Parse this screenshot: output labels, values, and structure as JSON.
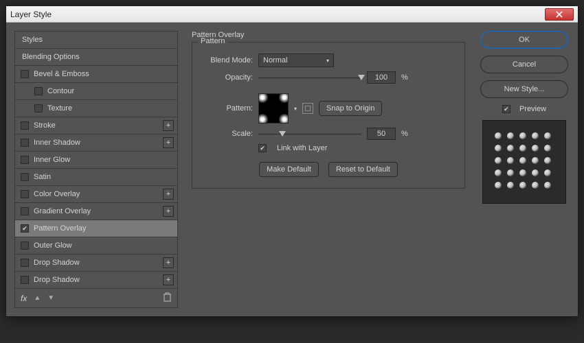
{
  "title": "Layer Style",
  "sidebar": {
    "styles_header": "Styles",
    "blending_header": "Blending Options",
    "items": [
      {
        "label": "Bevel & Emboss",
        "checked": false,
        "sub": false,
        "plus": false
      },
      {
        "label": "Contour",
        "checked": false,
        "sub": true,
        "plus": false
      },
      {
        "label": "Texture",
        "checked": false,
        "sub": true,
        "plus": false
      },
      {
        "label": "Stroke",
        "checked": false,
        "sub": false,
        "plus": true
      },
      {
        "label": "Inner Shadow",
        "checked": false,
        "sub": false,
        "plus": true
      },
      {
        "label": "Inner Glow",
        "checked": false,
        "sub": false,
        "plus": false
      },
      {
        "label": "Satin",
        "checked": false,
        "sub": false,
        "plus": false
      },
      {
        "label": "Color Overlay",
        "checked": false,
        "sub": false,
        "plus": true
      },
      {
        "label": "Gradient Overlay",
        "checked": false,
        "sub": false,
        "plus": true
      },
      {
        "label": "Pattern Overlay",
        "checked": true,
        "sub": false,
        "plus": false,
        "selected": true
      },
      {
        "label": "Outer Glow",
        "checked": false,
        "sub": false,
        "plus": false
      },
      {
        "label": "Drop Shadow",
        "checked": false,
        "sub": false,
        "plus": true
      },
      {
        "label": "Drop Shadow",
        "checked": false,
        "sub": false,
        "plus": true
      }
    ],
    "fx_label": "fx"
  },
  "panel": {
    "title": "Pattern Overlay",
    "group": "Pattern",
    "blend_mode_label": "Blend Mode:",
    "blend_mode_value": "Normal",
    "opacity_label": "Opacity:",
    "opacity_value": "100",
    "opacity_unit": "%",
    "pattern_label": "Pattern:",
    "snap_label": "Snap to Origin",
    "scale_label": "Scale:",
    "scale_value": "50",
    "scale_unit": "%",
    "link_label": "Link with Layer",
    "make_default": "Make Default",
    "reset_default": "Reset to Default"
  },
  "buttons": {
    "ok": "OK",
    "cancel": "Cancel",
    "new_style": "New Style...",
    "preview": "Preview"
  }
}
